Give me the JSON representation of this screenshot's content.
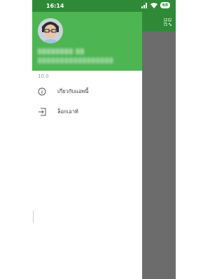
{
  "status_bar": {
    "time": "16:14",
    "battery": "68",
    "icons": [
      "signal-icon",
      "wifi-icon",
      "battery-icon"
    ]
  },
  "drawer": {
    "user_name": "▒▒▒▒▒▒▒▒ ▒▒",
    "user_email": "▒▒▒▒▒▒▒▒▒▒▒▒▒▒▒▒▒",
    "version": "10.0",
    "menu": [
      {
        "label": "เกี่ยวกับแอพนี้",
        "icon": "info-icon"
      },
      {
        "label": "ล็อกเอาท์",
        "icon": "logout-icon"
      }
    ]
  },
  "colors": {
    "header_green": "#4db552",
    "statusbar_green": "#2f8a37",
    "scrim_gray": "#6c6c6c"
  }
}
